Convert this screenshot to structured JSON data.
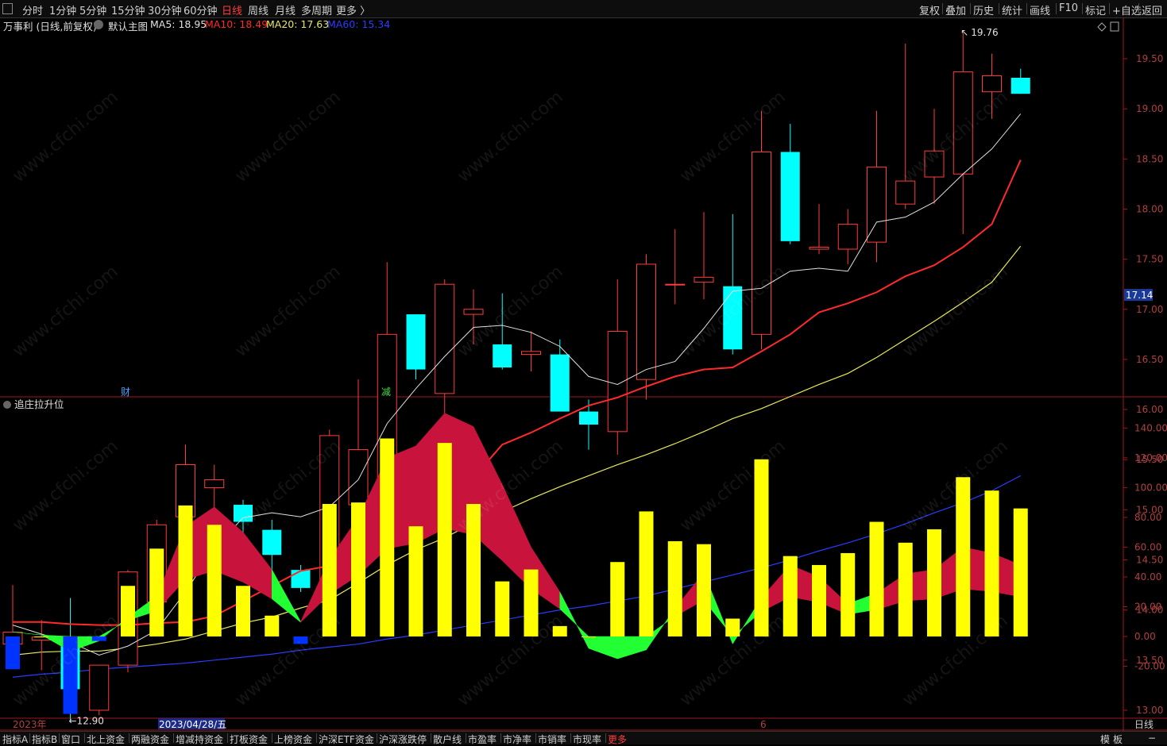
{
  "toolbar": {
    "left_items": [
      "分时",
      "1分钟",
      "5分钟",
      "15分钟",
      "30分钟",
      "60分钟",
      "日线",
      "周线",
      "月线",
      "多周期",
      "更多 〉"
    ],
    "selected": "日线",
    "right_items": [
      "复权",
      "叠加",
      "历史",
      "统计",
      "画线",
      "F10",
      "标记",
      "+自选",
      "返回"
    ]
  },
  "stock_info": {
    "name_period": "万事利 (日线,前复权)",
    "main_label": "默认主图",
    "ma5_label": "MA5: 18.95",
    "ma10_label": "MA10: 18.49",
    "ma20_label": "MA20: 17.63",
    "ma60_label": "MA60: 15.34",
    "colors": {
      "ma5": "#e0e0e0",
      "ma10": "#ff2a2a",
      "ma20": "#e8e85a",
      "ma60": "#2a3cff",
      "up": "#ff3b3b",
      "down": "#00ffff"
    }
  },
  "price_axis": {
    "ticks": [
      "19.50",
      "19.00",
      "18.50",
      "18.00",
      "17.50",
      "17.00",
      "16.50",
      "16.00",
      "15.50",
      "15.00",
      "14.50",
      "14.00",
      "13.50",
      "13.00"
    ],
    "current_price": "17.14"
  },
  "annotations": {
    "high_label": "19.76",
    "low_label": "12.90",
    "marker_cai": "财",
    "marker_jian": "减"
  },
  "indicator": {
    "title": "追庄拉升位",
    "ticks": [
      "140.00",
      "120.00",
      "100.00",
      "80.00",
      "60.00",
      "40.00",
      "20.00",
      "0.00",
      "-20.00"
    ]
  },
  "time_axis": {
    "left_label": "2023年",
    "cursor_label": "2023/04/28/五",
    "month_label": "6",
    "right_label": "日线"
  },
  "bottom_bar": {
    "items": [
      "指标A",
      "指标B",
      "窗口",
      "北上资金",
      "两融资金",
      "增减持资金",
      "打板资金",
      "上榜资金",
      "沪深ETF资金",
      "沪深涨跌停",
      "散户线",
      "市盈率",
      "市净率",
      "市销率",
      "市现率",
      "更多"
    ],
    "right_items": [
      "模",
      "板",
      "−"
    ]
  },
  "chart_data": [
    {
      "type": "candlestick",
      "title": "万事利 (日线,前复权)",
      "ylim": [
        12.6,
        19.9
      ],
      "candles": [
        {
          "o": 13.66,
          "h": 14.25,
          "l": 13.56,
          "c": 13.78
        },
        {
          "o": 13.7,
          "h": 13.9,
          "l": 13.4,
          "c": 13.73
        },
        {
          "o": 13.71,
          "h": 14.12,
          "l": 12.9,
          "c": 13.21
        },
        {
          "o": 13.0,
          "h": 13.45,
          "l": 12.95,
          "c": 13.45
        },
        {
          "o": 13.45,
          "h": 14.4,
          "l": 13.38,
          "c": 14.38
        },
        {
          "o": 14.08,
          "h": 14.9,
          "l": 14.0,
          "c": 14.85
        },
        {
          "o": 14.93,
          "h": 15.65,
          "l": 14.75,
          "c": 15.45
        },
        {
          "o": 15.22,
          "h": 15.45,
          "l": 14.95,
          "c": 15.3
        },
        {
          "o": 15.05,
          "h": 15.1,
          "l": 14.55,
          "c": 14.88
        },
        {
          "o": 14.8,
          "h": 14.9,
          "l": 14.35,
          "c": 14.55
        },
        {
          "o": 14.4,
          "h": 14.45,
          "l": 14.18,
          "c": 14.22
        },
        {
          "o": 14.25,
          "h": 15.8,
          "l": 14.18,
          "c": 15.74
        },
        {
          "o": 15.05,
          "h": 16.3,
          "l": 14.85,
          "c": 15.6
        },
        {
          "o": 15.05,
          "h": 17.47,
          "l": 14.95,
          "c": 16.75
        },
        {
          "o": 16.95,
          "h": 16.95,
          "l": 16.3,
          "c": 16.4
        },
        {
          "o": 16.16,
          "h": 17.3,
          "l": 15.85,
          "c": 17.25
        },
        {
          "o": 16.95,
          "h": 17.2,
          "l": 16.65,
          "c": 17.0
        },
        {
          "o": 16.65,
          "h": 17.16,
          "l": 16.4,
          "c": 16.42
        },
        {
          "o": 16.55,
          "h": 16.78,
          "l": 16.38,
          "c": 16.58
        },
        {
          "o": 16.55,
          "h": 16.7,
          "l": 15.98,
          "c": 15.98
        },
        {
          "o": 15.98,
          "h": 16.1,
          "l": 15.6,
          "c": 15.85
        },
        {
          "o": 15.78,
          "h": 17.3,
          "l": 15.55,
          "c": 16.78
        },
        {
          "o": 16.3,
          "h": 17.55,
          "l": 16.1,
          "c": 17.45
        },
        {
          "o": 17.25,
          "h": 17.8,
          "l": 17.05,
          "c": 17.25
        },
        {
          "o": 17.27,
          "h": 17.97,
          "l": 17.1,
          "c": 17.32
        },
        {
          "o": 17.23,
          "h": 17.95,
          "l": 16.55,
          "c": 16.6
        },
        {
          "o": 16.75,
          "h": 18.98,
          "l": 16.6,
          "c": 18.57
        },
        {
          "o": 18.57,
          "h": 18.85,
          "l": 17.65,
          "c": 17.68
        },
        {
          "o": 17.6,
          "h": 18.05,
          "l": 17.55,
          "c": 17.62
        },
        {
          "o": 17.6,
          "h": 18.0,
          "l": 17.45,
          "c": 17.85
        },
        {
          "o": 17.67,
          "h": 18.98,
          "l": 17.47,
          "c": 18.42
        },
        {
          "o": 18.05,
          "h": 19.65,
          "l": 18.0,
          "c": 18.28
        },
        {
          "o": 18.32,
          "h": 19.0,
          "l": 18.05,
          "c": 18.58
        },
        {
          "o": 18.35,
          "h": 19.76,
          "l": 17.75,
          "c": 19.37
        },
        {
          "o": 19.17,
          "h": 19.55,
          "l": 18.9,
          "c": 19.33
        },
        {
          "o": 19.31,
          "h": 19.4,
          "l": 19.15,
          "c": 19.15
        }
      ],
      "ma5": [
        13.85,
        13.76,
        13.68,
        13.55,
        13.64,
        13.8,
        14.18,
        14.62,
        14.92,
        14.97,
        14.93,
        15.03,
        15.3,
        15.86,
        16.21,
        16.53,
        16.82,
        16.84,
        16.77,
        16.63,
        16.33,
        16.25,
        16.4,
        16.48,
        16.81,
        17.18,
        17.21,
        17.38,
        17.41,
        17.38,
        17.87,
        17.92,
        18.07,
        18.35,
        18.6,
        18.95
      ],
      "ma10": [
        13.88,
        13.88,
        13.86,
        13.85,
        13.85,
        13.87,
        13.88,
        13.94,
        14.09,
        14.24,
        14.39,
        14.44,
        14.53,
        14.6,
        14.85,
        15.02,
        15.32,
        15.65,
        15.77,
        15.91,
        16.04,
        16.12,
        16.23,
        16.33,
        16.4,
        16.42,
        16.58,
        16.75,
        16.97,
        17.06,
        17.17,
        17.33,
        17.44,
        17.62,
        17.85,
        18.49
      ],
      "ma20": [
        13.55,
        13.58,
        13.59,
        13.59,
        13.62,
        13.66,
        13.71,
        13.79,
        13.87,
        13.93,
        14.02,
        14.1,
        14.27,
        14.45,
        14.6,
        14.72,
        14.87,
        14.98,
        15.11,
        15.23,
        15.34,
        15.45,
        15.55,
        15.66,
        15.78,
        15.91,
        16.01,
        16.13,
        16.25,
        16.36,
        16.52,
        16.7,
        16.88,
        17.07,
        17.27,
        17.63
      ],
      "ma60": [
        13.33,
        13.36,
        13.38,
        13.41,
        13.43,
        13.45,
        13.47,
        13.5,
        13.53,
        13.56,
        13.6,
        13.63,
        13.66,
        13.71,
        13.75,
        13.8,
        13.85,
        13.9,
        13.95,
        14.0,
        14.04,
        14.09,
        14.14,
        14.21,
        14.28,
        14.35,
        14.42,
        14.5,
        14.59,
        14.67,
        14.76,
        14.86,
        14.97,
        15.07,
        15.19,
        15.34
      ]
    },
    {
      "type": "bar",
      "title": "追庄拉升位",
      "ylim": [
        -40,
        150
      ],
      "bars": [
        -22,
        0,
        -52,
        -3,
        34,
        59,
        88,
        75,
        34,
        14,
        -5,
        89,
        90,
        133,
        74,
        130,
        89,
        37,
        45,
        7,
        0,
        50,
        84,
        64,
        62,
        12,
        119,
        54,
        48,
        56,
        77,
        63,
        72,
        107,
        98,
        86
      ],
      "band": [
        3,
        1,
        -10,
        -3,
        13,
        27,
        74,
        87,
        70,
        45,
        10,
        52,
        80,
        120,
        128,
        150,
        141,
        102,
        60,
        30,
        -8,
        -15,
        -9,
        19,
        43,
        -5,
        26,
        48,
        40,
        22,
        29,
        42,
        45,
        60,
        56,
        48
      ]
    }
  ]
}
